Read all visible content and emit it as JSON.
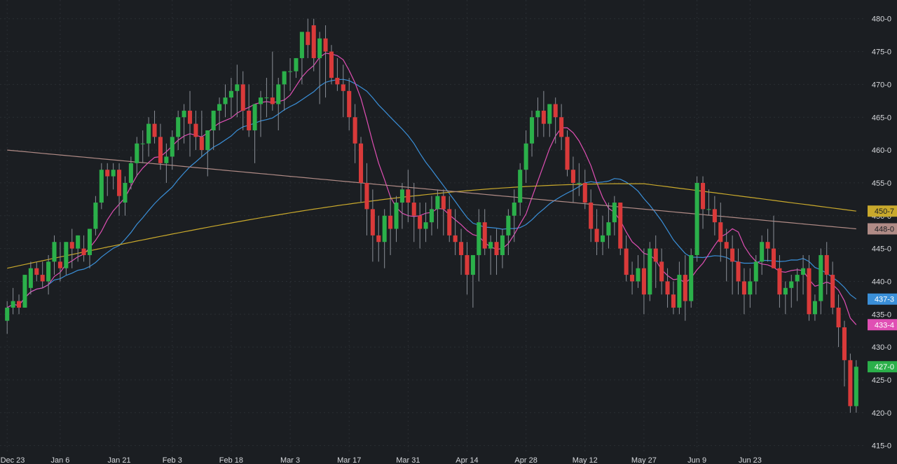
{
  "chart_data": {
    "type": "candlestick",
    "y_axis": {
      "range": [
        414,
        482
      ],
      "ticks": [
        "415-0",
        "420-0",
        "425-0",
        "430-0",
        "435-0",
        "440-0",
        "445-0",
        "450-0",
        "455-0",
        "460-0",
        "465-0",
        "470-0",
        "475-0",
        "480-0"
      ],
      "tick_values": [
        415,
        420,
        425,
        430,
        435,
        440,
        445,
        450,
        455,
        460,
        465,
        470,
        475,
        480
      ],
      "position": "right"
    },
    "x_axis": {
      "labels": [
        "Dec 23",
        "Jan 6",
        "Jan 21",
        "Feb 3",
        "Feb 18",
        "Mar 3",
        "Mar 17",
        "Mar 31",
        "Apr 14",
        "Apr 28",
        "May 12",
        "May 27",
        "Jun 9",
        "Jun 23"
      ],
      "label_indices": [
        0,
        9,
        19,
        28,
        38,
        48,
        58,
        68,
        78,
        88,
        98,
        108,
        117,
        126
      ]
    },
    "grid": true,
    "colors": {
      "background": "#1b1e22",
      "up": "#2bb04a",
      "down": "#d93a3a",
      "grid": "#2a2e33",
      "axis_text": "#d6d8dc"
    },
    "candles": [
      [
        434,
        437,
        432,
        436
      ],
      [
        436,
        439,
        435,
        437
      ],
      [
        437,
        438,
        435,
        436
      ],
      [
        436,
        441,
        436,
        441
      ],
      [
        439,
        443,
        438,
        442
      ],
      [
        442,
        443,
        440,
        441
      ],
      [
        441,
        443,
        439,
        440
      ],
      [
        440,
        444,
        438,
        443
      ],
      [
        443,
        447,
        441,
        446
      ],
      [
        443,
        446,
        440,
        442
      ],
      [
        442,
        446,
        441,
        446
      ],
      [
        446,
        448,
        442,
        445
      ],
      [
        445,
        447,
        443,
        447
      ],
      [
        445,
        447,
        443,
        444
      ],
      [
        444,
        448,
        442,
        448
      ],
      [
        448,
        453,
        447,
        452
      ],
      [
        452,
        458,
        451,
        457
      ],
      [
        457,
        458,
        453,
        456
      ],
      [
        456,
        458,
        454,
        457
      ],
      [
        457,
        458,
        450,
        453
      ],
      [
        452,
        456,
        450,
        455
      ],
      [
        455,
        459,
        454,
        458
      ],
      [
        458,
        462,
        456,
        461
      ],
      [
        461,
        463,
        458,
        461
      ],
      [
        461,
        465,
        459,
        464
      ],
      [
        464,
        466,
        461,
        462
      ],
      [
        462,
        464,
        457,
        458
      ],
      [
        458,
        461,
        455,
        459
      ],
      [
        459,
        463,
        457,
        462
      ],
      [
        462,
        466,
        460,
        465
      ],
      [
        465,
        467,
        461,
        466
      ],
      [
        466,
        469,
        459,
        464
      ],
      [
        464,
        466,
        460,
        462
      ],
      [
        462,
        466,
        459,
        460
      ],
      [
        460,
        463,
        456,
        463
      ],
      [
        463,
        466,
        460,
        466
      ],
      [
        466,
        468,
        463,
        467
      ],
      [
        467,
        470,
        465,
        468
      ],
      [
        468,
        471,
        465,
        469
      ],
      [
        469,
        473,
        465,
        470
      ],
      [
        470,
        472,
        463,
        466
      ],
      [
        466,
        470,
        462,
        463
      ],
      [
        463,
        467,
        458,
        467
      ],
      [
        467,
        469,
        462,
        468
      ],
      [
        468,
        471,
        465,
        468
      ],
      [
        468,
        475,
        466,
        467
      ],
      [
        467,
        471,
        463,
        470
      ],
      [
        470,
        472,
        466,
        472
      ],
      [
        472,
        474,
        469,
        472
      ],
      [
        472,
        474,
        471,
        474
      ],
      [
        474,
        478,
        470,
        478
      ],
      [
        478,
        480,
        474,
        476
      ],
      [
        479,
        480,
        472,
        474
      ],
      [
        474,
        478,
        467,
        477
      ],
      [
        477,
        479,
        468,
        475
      ],
      [
        475,
        476,
        470,
        471
      ],
      [
        471,
        474,
        469,
        470
      ],
      [
        470,
        473,
        465,
        469
      ],
      [
        469,
        471,
        463,
        465
      ],
      [
        465,
        467,
        458,
        461
      ],
      [
        461,
        462,
        452,
        455
      ],
      [
        455,
        458,
        447,
        451
      ],
      [
        451,
        454,
        443,
        447
      ],
      [
        447,
        450,
        443,
        446
      ],
      [
        446,
        451,
        442,
        450
      ],
      [
        450,
        453,
        444,
        448
      ],
      [
        448,
        453,
        446,
        452
      ],
      [
        452,
        455,
        448,
        454
      ],
      [
        454,
        457,
        449,
        452
      ],
      [
        452,
        455,
        446,
        450
      ],
      [
        450,
        452,
        445,
        448
      ],
      [
        448,
        452,
        446,
        449
      ],
      [
        449,
        453,
        447,
        451
      ],
      [
        451,
        454,
        448,
        453
      ],
      [
        453,
        454,
        447,
        451
      ],
      [
        451,
        453,
        446,
        447
      ],
      [
        447,
        451,
        444,
        446
      ],
      [
        446,
        448,
        441,
        444
      ],
      [
        444,
        446,
        438,
        441
      ],
      [
        441,
        444,
        436,
        444
      ],
      [
        444,
        451,
        440,
        449
      ],
      [
        449,
        451,
        444,
        445
      ],
      [
        445,
        447,
        441,
        446
      ],
      [
        446,
        448,
        441,
        444
      ],
      [
        444,
        448,
        442,
        447
      ],
      [
        447,
        451,
        444,
        450
      ],
      [
        450,
        454,
        446,
        452
      ],
      [
        452,
        458,
        450,
        457
      ],
      [
        457,
        463,
        455,
        461
      ],
      [
        461,
        466,
        459,
        465
      ],
      [
        465,
        468,
        462,
        466
      ],
      [
        466,
        469,
        462,
        464
      ],
      [
        464,
        467,
        462,
        467
      ],
      [
        467,
        468,
        461,
        465
      ],
      [
        465,
        467,
        460,
        462
      ],
      [
        462,
        463,
        456,
        457
      ],
      [
        457,
        459,
        452,
        455
      ],
      [
        455,
        458,
        453,
        455
      ],
      [
        455,
        457,
        451,
        452
      ],
      [
        452,
        454,
        446,
        448
      ],
      [
        448,
        451,
        444,
        446
      ],
      [
        446,
        450,
        444,
        447
      ],
      [
        447,
        452,
        445,
        449
      ],
      [
        449,
        453,
        447,
        452
      ],
      [
        452,
        452,
        444,
        445
      ],
      [
        445,
        447,
        440,
        441
      ],
      [
        441,
        443,
        438,
        440
      ],
      [
        440,
        444,
        439,
        442
      ],
      [
        442,
        445,
        435,
        438
      ],
      [
        438,
        446,
        437,
        445
      ],
      [
        445,
        447,
        439,
        443
      ],
      [
        443,
        445,
        438,
        440
      ],
      [
        440,
        442,
        436,
        438
      ],
      [
        438,
        440,
        435,
        436
      ],
      [
        436,
        443,
        435,
        441
      ],
      [
        441,
        444,
        434,
        437
      ],
      [
        437,
        445,
        436,
        444
      ],
      [
        444,
        456,
        443,
        455
      ],
      [
        455,
        456,
        448,
        451
      ],
      [
        451,
        454,
        450,
        451
      ],
      [
        451,
        453,
        447,
        449
      ],
      [
        449,
        452,
        443,
        446
      ],
      [
        446,
        448,
        440,
        445
      ],
      [
        445,
        447,
        438,
        443
      ],
      [
        443,
        445,
        438,
        440
      ],
      [
        440,
        442,
        435,
        438
      ],
      [
        438,
        442,
        436,
        440
      ],
      [
        440,
        444,
        438,
        443
      ],
      [
        443,
        447,
        441,
        446
      ],
      [
        446,
        448,
        443,
        445
      ],
      [
        445,
        450,
        442,
        442
      ],
      [
        442,
        444,
        436,
        438
      ],
      [
        438,
        440,
        435,
        439
      ],
      [
        439,
        441,
        436,
        440
      ],
      [
        440,
        442,
        437,
        441
      ],
      [
        441,
        444,
        438,
        442
      ],
      [
        442,
        444,
        434,
        435
      ],
      [
        435,
        438,
        434,
        437
      ],
      [
        437,
        445,
        435,
        444
      ],
      [
        444,
        446,
        438,
        441
      ],
      [
        441,
        443,
        435,
        436
      ],
      [
        436,
        438,
        430,
        433
      ],
      [
        433,
        434,
        424,
        428
      ],
      [
        428,
        429,
        420,
        421
      ],
      [
        421,
        428,
        420,
        427
      ]
    ],
    "series": [
      {
        "color": "#3a8fd8",
        "last_value": 437.3,
        "label": "437-3"
      },
      {
        "color": "#e04fb4",
        "last_value": 433.4,
        "label": "433-4"
      },
      {
        "color": "#c9a92c",
        "last_value": 450.7,
        "label": "450-7"
      },
      {
        "color": "#b08b86",
        "last_value": 448.0,
        "label": "448-0"
      }
    ],
    "price_badge": {
      "value": 427.0,
      "label": "427-0",
      "color": "#2bb04a"
    }
  }
}
